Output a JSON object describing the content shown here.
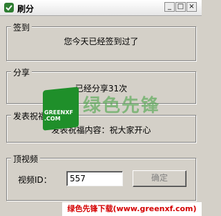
{
  "window": {
    "title": "刷分"
  },
  "titlebar_buttons": {
    "minimize": "_",
    "maximize": "□",
    "close": "×"
  },
  "groups": {
    "signin": {
      "title": "签到",
      "message": "您今天已经签到过了"
    },
    "share": {
      "title": "分享",
      "message": "已经分享31次"
    },
    "blessing": {
      "title": "发表祝福",
      "message": "发表祝福内容：祝大家开心"
    },
    "top_video": {
      "title": "顶视频",
      "video_id_label": "视频ID：",
      "video_id_value": "557",
      "confirm_label": "确定"
    }
  },
  "watermark": {
    "logo_text_1": "GREENXF",
    "logo_text_2": ".COM",
    "word": "绿色先锋"
  },
  "banner": {
    "text": "绿色先锋下载(www.greenxf.com)"
  },
  "colors": {
    "window_bg": "#d4d0c8",
    "banner_text": "#d40000",
    "watermark_green": "#1f8f2a"
  }
}
